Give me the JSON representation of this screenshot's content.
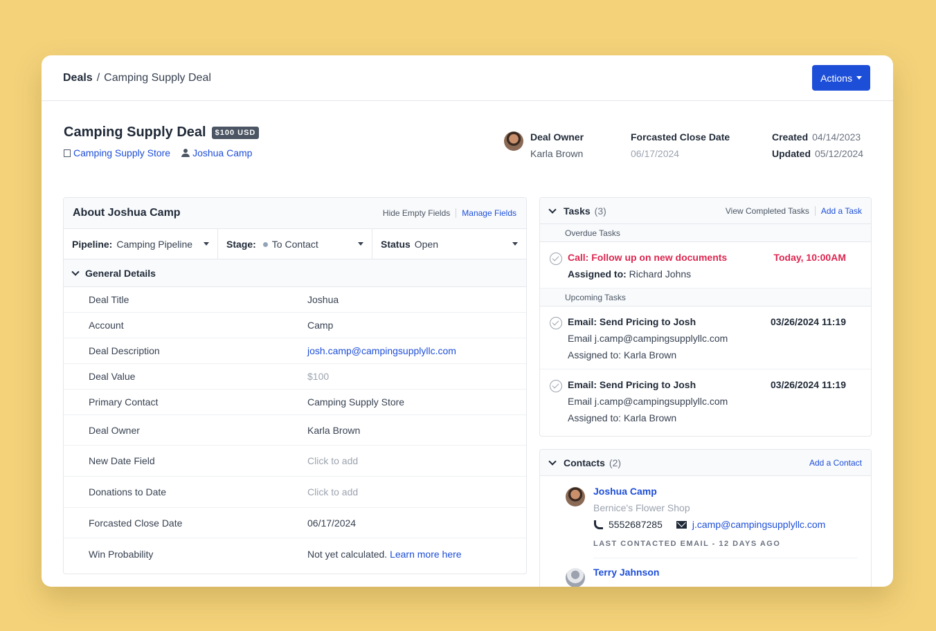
{
  "breadcrumb": {
    "root": "Deals",
    "separator": "/",
    "current": "Camping Supply Deal"
  },
  "actions_label": "Actions",
  "deal": {
    "title": "Camping Supply Deal",
    "value_badge": "$100 USD",
    "account_link": "Camping Supply Store",
    "contact_link": "Joshua Camp"
  },
  "meta": {
    "owner_label": "Deal Owner",
    "owner_value": "Karla Brown",
    "close_label": "Forcasted Close Date",
    "close_value": "06/17/2024",
    "created_label": "Created",
    "created_value": "04/14/2023",
    "updated_label": "Updated",
    "updated_value": "05/12/2024"
  },
  "about": {
    "title": "About Joshua Camp",
    "hide_empty": "Hide Empty Fields",
    "manage_fields": "Manage Fields",
    "pipeline_label": "Pipeline:",
    "pipeline_value": "Camping Pipeline",
    "stage_label": "Stage:",
    "stage_value": "To Contact",
    "status_label": "Status",
    "status_value": "Open",
    "section_title": "General Details",
    "fields": [
      {
        "label": "Deal Title",
        "value": "Joshua"
      },
      {
        "label": "Account",
        "value": "Camp"
      },
      {
        "label": "Deal Description",
        "value": "josh.camp@campingsupplyllc.com"
      },
      {
        "label": "Deal Value",
        "value": "$100"
      },
      {
        "label": "Primary Contact",
        "value": "Camping Supply Store"
      },
      {
        "label": "Deal Owner",
        "value": "Karla Brown"
      },
      {
        "label": "New Date Field",
        "value": "Click to add"
      },
      {
        "label": "Donations to Date",
        "value": "Click to add"
      },
      {
        "label": "Forcasted Close Date",
        "value": "06/17/2024"
      },
      {
        "label": "Win Probability",
        "value": "Not yet calculated.",
        "link": "Learn more here"
      }
    ]
  },
  "tasks": {
    "title": "Tasks",
    "count": "(3)",
    "view_completed": "View Completed Tasks",
    "add_task": "Add a Task",
    "overdue_label": "Overdue Tasks",
    "upcoming_label": "Upcoming Tasks",
    "overdue": [
      {
        "name": "Call: Follow up on new documents",
        "date": "Today, 10:00AM",
        "assigned_label": "Assigned to:",
        "assigned": "Richard Johns"
      }
    ],
    "upcoming": [
      {
        "name": "Email: Send Pricing to Josh",
        "date": "03/26/2024 11:19",
        "detail": "Email j.camp@campingsupplyllc.com",
        "assigned_label": "Assigned to:",
        "assigned": "Karla Brown"
      },
      {
        "name": "Email: Send Pricing to Josh",
        "date": "03/26/2024 11:19",
        "detail": "Email j.camp@campingsupplyllc.com",
        "assigned_label": "Assigned to:",
        "assigned": "Karla Brown"
      }
    ]
  },
  "contacts": {
    "title": "Contacts",
    "count": "(2)",
    "add_contact": "Add a Contact",
    "items": [
      {
        "name": "Joshua Camp",
        "company": "Bernice's Flower Shop",
        "phone": "5552687285",
        "email": "j.camp@campingsupplyllc.com",
        "last_contacted": "LAST CONTACTED EMAIL - 12 DAYS AGO"
      },
      {
        "name": "Terry Jahnson"
      }
    ]
  }
}
